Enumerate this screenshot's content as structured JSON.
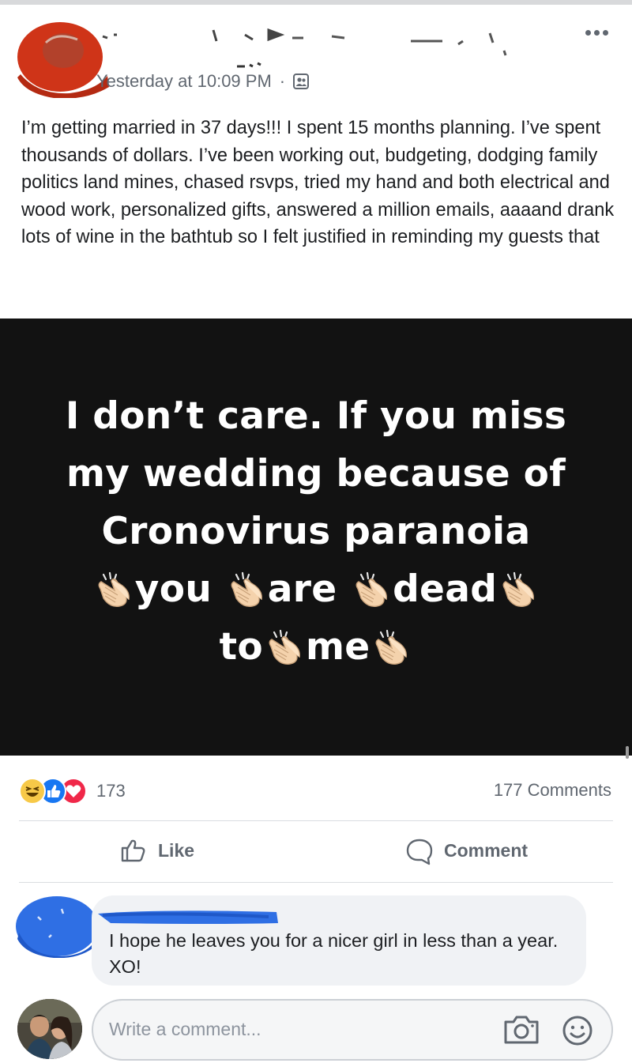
{
  "post": {
    "timestamp": "Yesterday at 10:09 PM",
    "separator": "·",
    "audience_icon": "friends-group-icon",
    "more_icon": "more-dots-icon",
    "text": "I’m getting married in 37 days!!! I spent 15 months planning. I’ve spent thousands of dollars. I’ve been working out, budgeting, dodging family politics land mines, chased rsvps, tried my hand and both electrical and wood work, personalized gifts, answered a million emails, aaaand drank lots of wine in the bathtub so I felt justified in reminding my guests that"
  },
  "media": {
    "line1": "I don’t care. If you miss",
    "line2": "my wedding because of",
    "line3": "Cronovirus paranoia",
    "line4_words": [
      "you",
      "are",
      "dead"
    ],
    "line5_words": [
      "to",
      "me"
    ],
    "emoji_icon": "clapping-hands-icon",
    "background_color": "#121212"
  },
  "engagement": {
    "reactions": [
      "haha-icon",
      "like-icon",
      "love-icon"
    ],
    "reaction_count": "173",
    "comment_count": "177 Comments"
  },
  "actions": {
    "like_label": "Like",
    "comment_label": "Comment"
  },
  "comment": {
    "text": "I hope he leaves you for a nicer girl in less than a year. XO!"
  },
  "composer": {
    "placeholder": "Write a comment...",
    "camera_icon": "camera-icon",
    "emoji_icon": "smiley-icon"
  },
  "colors": {
    "text": "#1c1e21",
    "muted": "#606770",
    "like_blue": "#1877f2",
    "love_red": "#f02849",
    "haha_yellow": "#f7c948",
    "redaction_red": "#d8321c",
    "redaction_blue": "#2f6fe4"
  }
}
